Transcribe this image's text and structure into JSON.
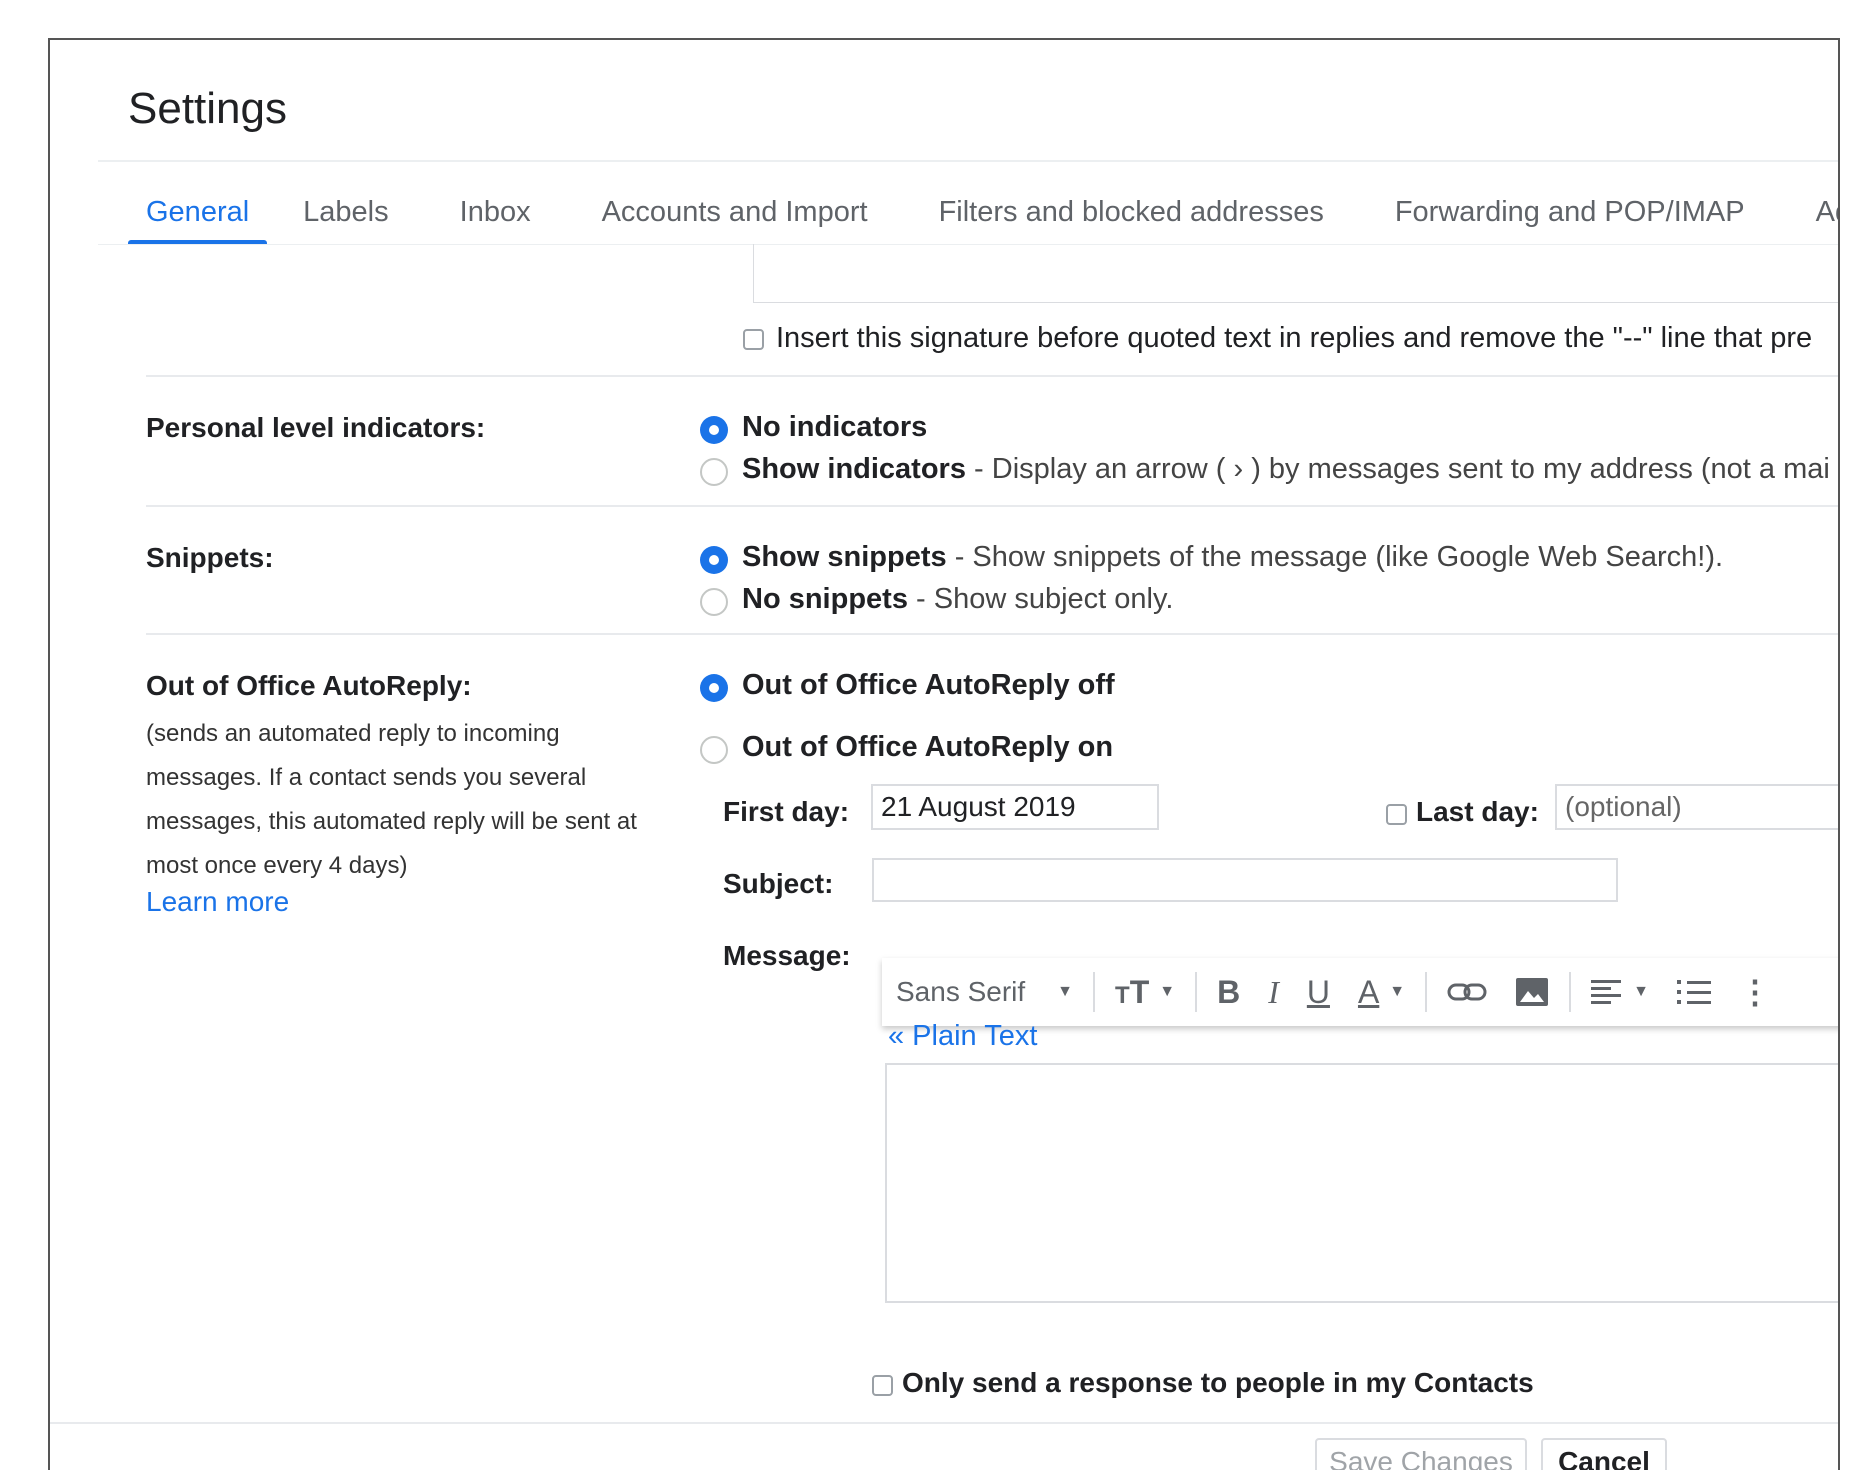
{
  "settings": {
    "title": "Settings",
    "tabs": [
      {
        "label": "General",
        "active": true
      },
      {
        "label": "Labels"
      },
      {
        "label": "Inbox"
      },
      {
        "label": "Accounts and Import"
      },
      {
        "label": "Filters and blocked addresses"
      },
      {
        "label": "Forwarding and POP/IMAP"
      },
      {
        "label": "Add-ons"
      }
    ],
    "signature_option": "Insert this signature before quoted text in replies and remove the \"--\" line that pre",
    "personal_level": {
      "label": "Personal level indicators:",
      "options": [
        {
          "bold": "No indicators",
          "rest": "",
          "selected": true
        },
        {
          "bold": "Show indicators",
          "rest": " - Display an arrow ( › ) by messages sent to my address (not a mai",
          "selected": false
        }
      ]
    },
    "snippets": {
      "label": "Snippets:",
      "options": [
        {
          "bold": "Show snippets",
          "rest": " - Show snippets of the message (like Google Web Search!).",
          "selected": true
        },
        {
          "bold": "No snippets",
          "rest": " - Show subject only.",
          "selected": false
        }
      ]
    },
    "autoreply": {
      "label": "Out of Office AutoReply:",
      "description_lines": [
        "(sends an automated reply to incoming",
        "messages. If a contact sends you several",
        "messages, this automated reply will be sent at",
        "most once every 4 days)"
      ],
      "learn_more": "Learn more",
      "options": [
        {
          "label": "Out of Office AutoReply off",
          "selected": true
        },
        {
          "label": "Out of Office AutoReply on",
          "selected": false
        }
      ],
      "first_day_label": "First day:",
      "first_day_value": "21 August 2019",
      "last_day_label": "Last day:",
      "last_day_placeholder": "(optional)",
      "subject_label": "Subject:",
      "subject_value": "",
      "message_label": "Message:",
      "toolbar": {
        "font": "Sans Serif",
        "bold": "B",
        "italic": "I",
        "underline": "U",
        "text_color": "A"
      },
      "plain_text_link": "« Plain Text",
      "contacts_only": "Only send a response to people in my Contacts"
    },
    "buttons": {
      "save": "Save Changes",
      "cancel": "Cancel"
    },
    "colors": {
      "accent": "#1a73e8",
      "text": "#202124",
      "border": "#dadce0"
    }
  }
}
